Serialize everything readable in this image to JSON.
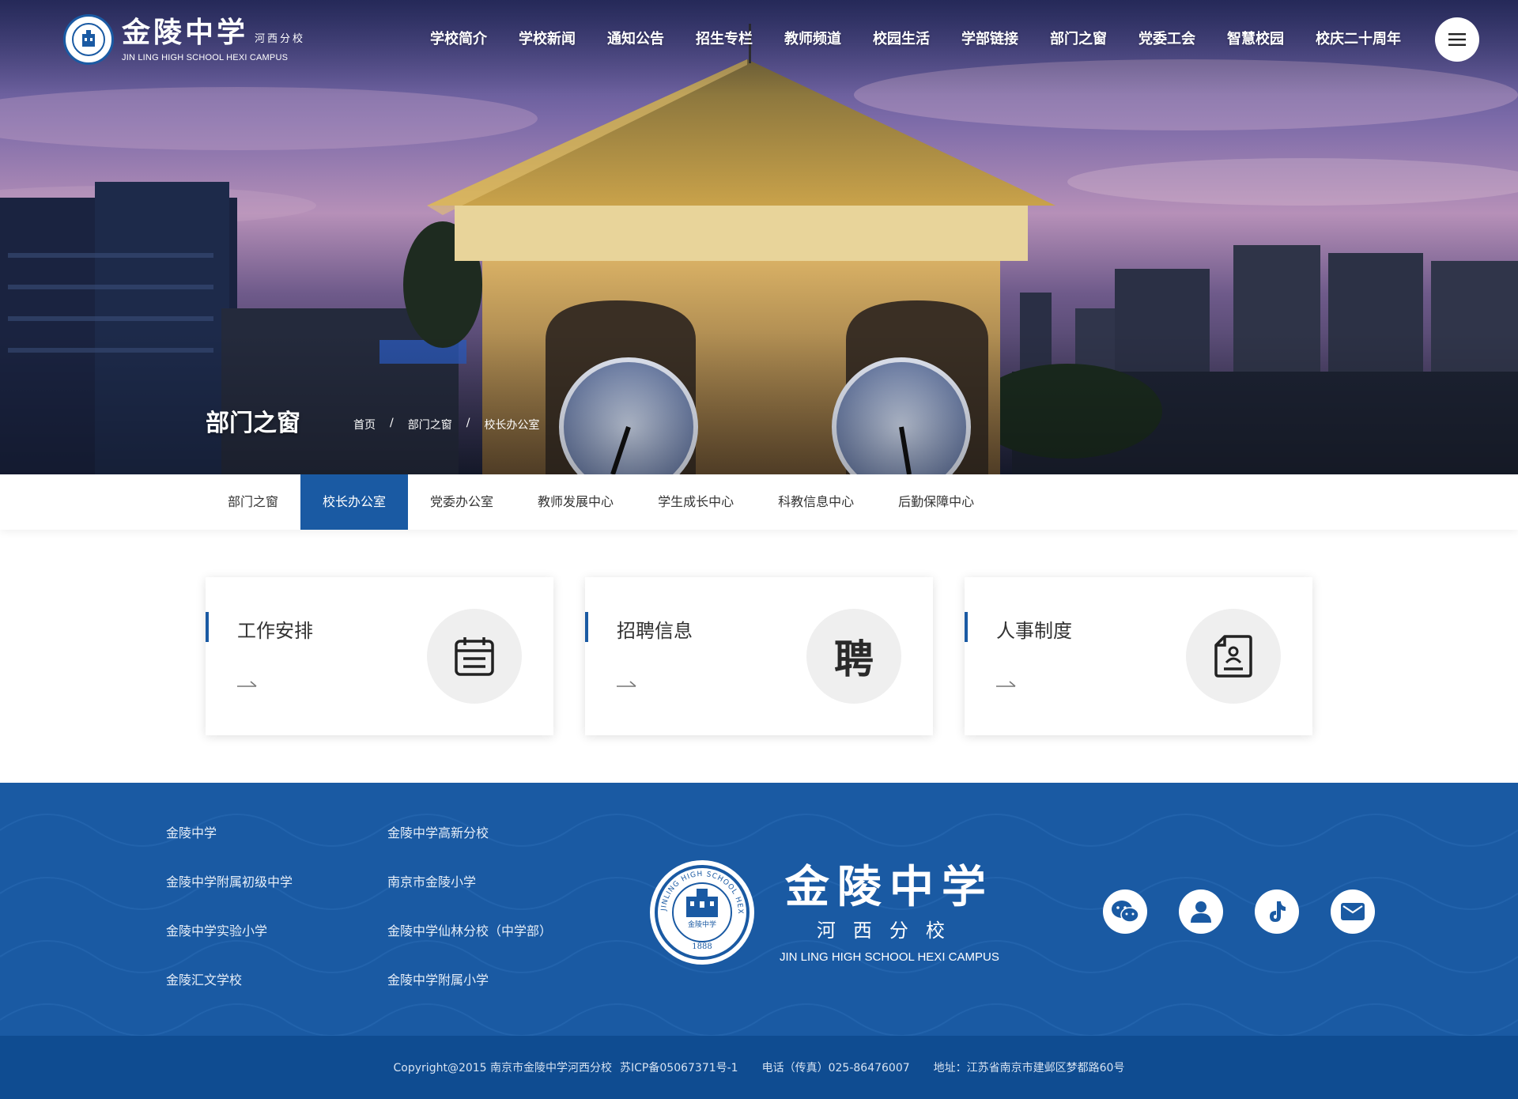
{
  "header": {
    "logo_cn": "金陵中学",
    "logo_branch": "河西分校",
    "logo_en": "JIN LING HIGH SCHOOL HEXI CAMPUS",
    "nav": [
      "学校简介",
      "学校新闻",
      "通知公告",
      "招生专栏",
      "教师频道",
      "校园生活",
      "学部链接",
      "部门之窗",
      "党委工会",
      "智慧校园",
      "校庆二十周年"
    ],
    "menu_icon": "hamburger-icon"
  },
  "hero": {
    "heading": "部门之窗",
    "breadcrumb": [
      "首页",
      "部门之窗",
      "校长办公室"
    ],
    "breadcrumb_sep": "/"
  },
  "subnav": {
    "tabs": [
      "部门之窗",
      "校长办公室",
      "党委办公室",
      "教师发展中心",
      "学生成长中心",
      "科教信息中心",
      "后勤保障中心"
    ],
    "active": "校长办公室"
  },
  "cards": [
    {
      "title": "工作安排",
      "icon": "calendar-icon"
    },
    {
      "title": "招聘信息",
      "icon": "recruit-icon",
      "glyph": "聘"
    },
    {
      "title": "人事制度",
      "icon": "document-icon"
    }
  ],
  "footer": {
    "links_col1": [
      "金陵中学",
      "金陵中学附属初级中学",
      "金陵中学实验小学",
      "金陵汇文学校"
    ],
    "links_col2": [
      "金陵中学高新分校",
      "南京市金陵小学",
      "金陵中学仙林分校（中学部）",
      "金陵中学附属小学"
    ],
    "logo_cn": "金陵中学",
    "logo_branch": "河西分校",
    "logo_en": "JIN LING HIGH SCHOOL HEXI CAMPUS",
    "emblem_ring_text": "JINLING HIGH SCHOOL HEXI CAMPUS",
    "emblem_year": "1888",
    "emblem_cn": "金陵中学",
    "socials": [
      "wechat-icon",
      "user-icon",
      "tiktok-icon",
      "mail-icon"
    ]
  },
  "bottom": {
    "copyright": "Copyright@2015 南京市金陵中学河西分校",
    "icp": "苏ICP备05067371号-1",
    "phone": "电话（传真）025-86476007",
    "address": "地址：江苏省南京市建邺区梦都路60号"
  },
  "colors": {
    "primary": "#1a5aa3",
    "footer_bar": "#0f4c91"
  }
}
